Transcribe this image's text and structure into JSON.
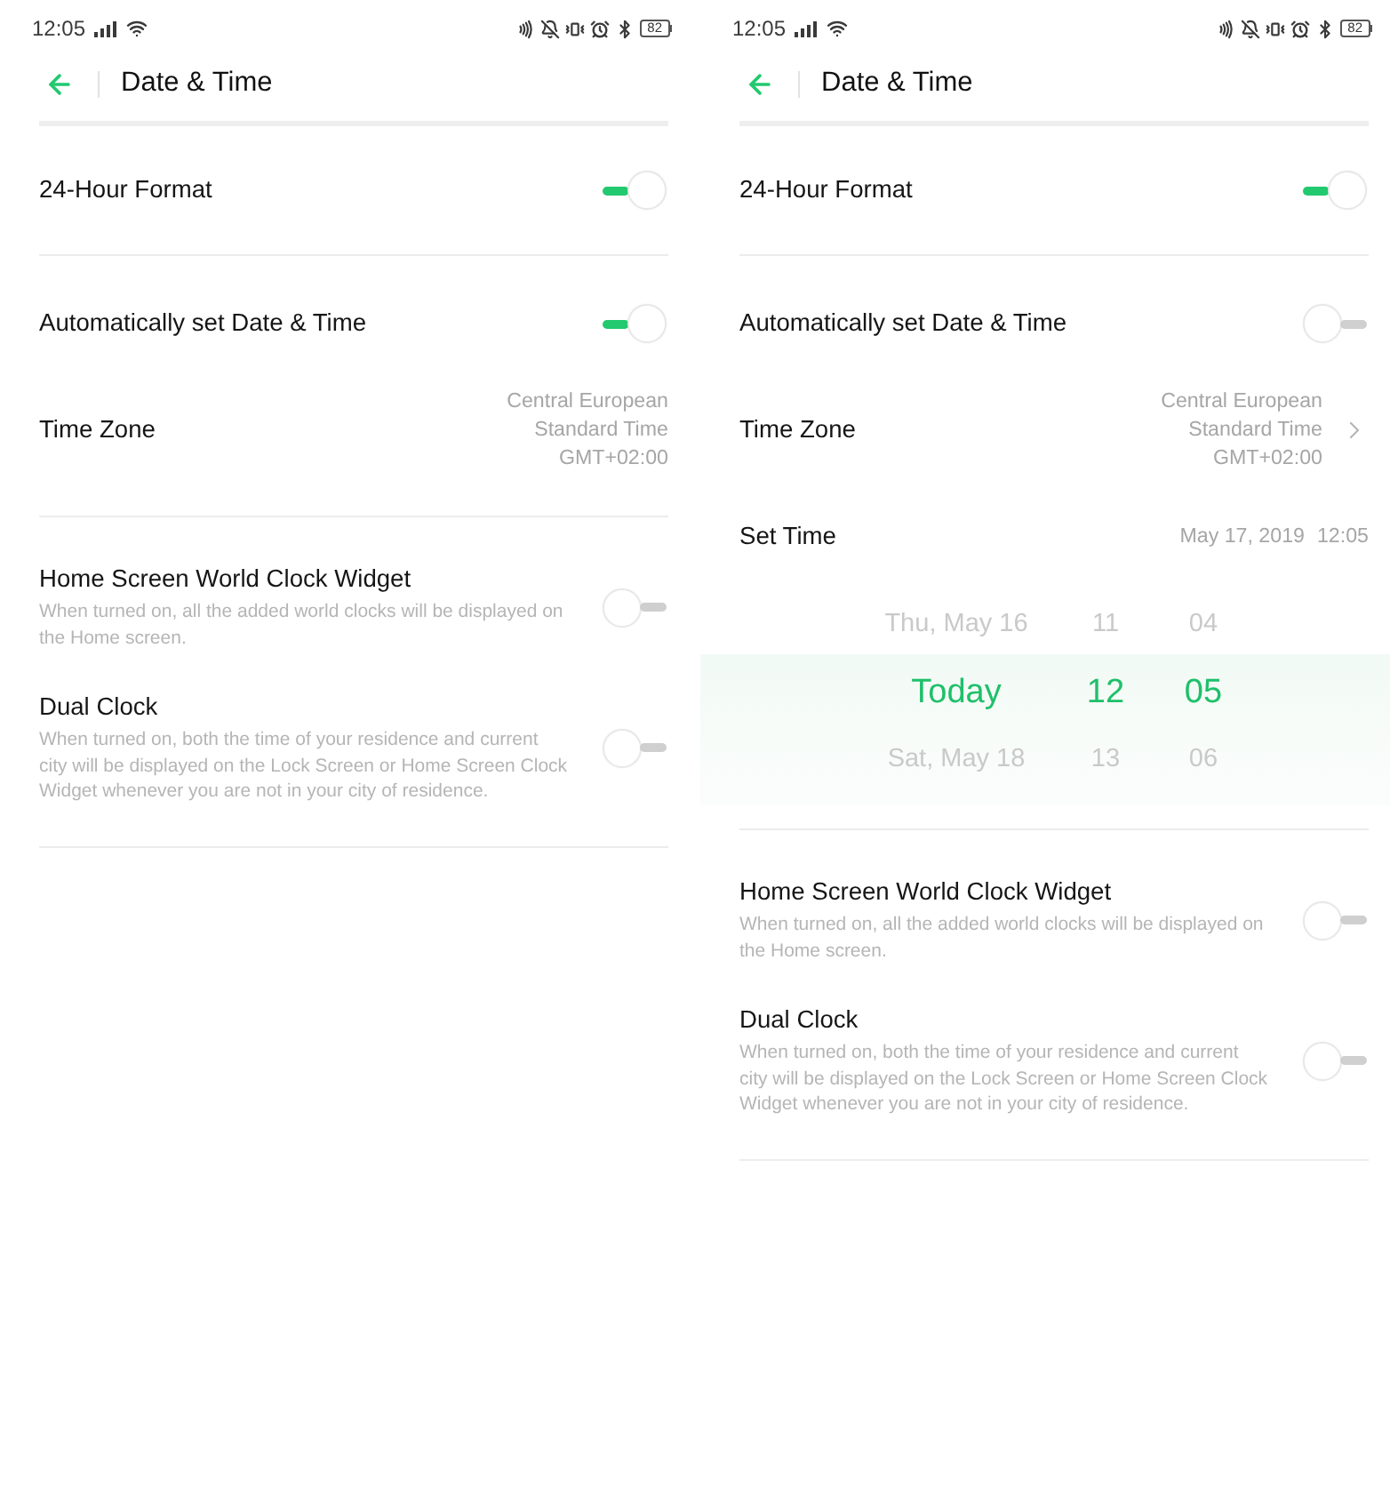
{
  "screens": [
    {
      "status_bar": {
        "time": "12:05",
        "battery": "82"
      },
      "header": {
        "title": "Date & Time"
      },
      "sections": [
        {
          "items": [
            {
              "kind": "toggle",
              "label": "24-Hour Format",
              "on": true
            }
          ]
        },
        {
          "items": [
            {
              "kind": "toggle",
              "label": "Automatically set Date & Time",
              "on": true
            },
            {
              "kind": "value",
              "label": "Time Zone",
              "value_lines": [
                "Central European",
                "Standard Time",
                "GMT+02:00"
              ],
              "chevron": false
            }
          ]
        },
        {
          "items": [
            {
              "kind": "toggle",
              "label": "Home Screen World Clock Widget",
              "description": "When turned on, all the added world clocks will be displayed on the Home screen.",
              "on": false
            },
            {
              "kind": "toggle",
              "label": "Dual Clock",
              "description": "When turned on, both the time of your residence and current city will be displayed on the Lock Screen or Home Screen Clock Widget whenever you are not in your city of residence.",
              "on": false
            }
          ]
        }
      ]
    },
    {
      "status_bar": {
        "time": "12:05",
        "battery": "82"
      },
      "header": {
        "title": "Date & Time"
      },
      "sections": [
        {
          "items": [
            {
              "kind": "toggle",
              "label": "24-Hour Format",
              "on": true
            }
          ]
        },
        {
          "items": [
            {
              "kind": "toggle",
              "label": "Automatically set Date & Time",
              "on": false
            },
            {
              "kind": "value",
              "label": "Time Zone",
              "value_lines": [
                "Central European",
                "Standard Time",
                "GMT+02:00"
              ],
              "chevron": true
            },
            {
              "kind": "datetime",
              "label": "Set Time",
              "date": "May 17, 2019",
              "time": "12:05"
            },
            {
              "kind": "picker",
              "columns": [
                {
                  "items": [
                    {
                      "text": "Thu, May 16",
                      "selected": false
                    },
                    {
                      "text": "Today",
                      "selected": true
                    },
                    {
                      "text": "Sat, May 18",
                      "selected": false
                    }
                  ]
                },
                {
                  "items": [
                    {
                      "text": "11",
                      "selected": false
                    },
                    {
                      "text": "12",
                      "selected": true
                    },
                    {
                      "text": "13",
                      "selected": false
                    }
                  ]
                },
                {
                  "items": [
                    {
                      "text": "04",
                      "selected": false
                    },
                    {
                      "text": "05",
                      "selected": true
                    },
                    {
                      "text": "06",
                      "selected": false
                    }
                  ]
                }
              ]
            }
          ]
        },
        {
          "items": [
            {
              "kind": "toggle",
              "label": "Home Screen World Clock Widget",
              "description": "When turned on, all the added world clocks will be displayed on the Home screen.",
              "on": false
            },
            {
              "kind": "toggle",
              "label": "Dual Clock",
              "description": "When turned on, both the time of your residence and current city will be displayed on the Lock Screen or Home Screen Clock Widget whenever you are not in your city of residence.",
              "on": false
            }
          ]
        }
      ]
    }
  ]
}
